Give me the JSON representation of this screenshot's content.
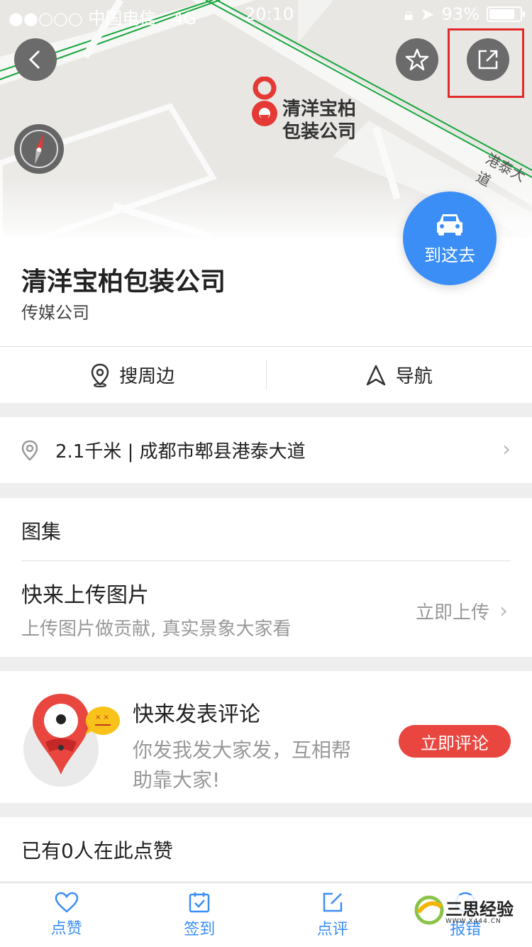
{
  "status_bar": {
    "signal": "●●○○○",
    "carrier": "中国电信",
    "network": "4G",
    "time": "20:10",
    "battery_percent": "93%",
    "battery_level": 0.93
  },
  "map": {
    "pin_label_line1": "清洋宝柏",
    "pin_label_line2": "包装公司",
    "road_label": "港泰大道",
    "go_button_label": "到这去"
  },
  "place": {
    "name": "清洋宝柏包装公司",
    "category": "传媒公司"
  },
  "actions": {
    "nearby_label": "搜周边",
    "navigate_label": "导航"
  },
  "address": {
    "text": "2.1千米 | 成都市郫县港泰大道"
  },
  "gallery": {
    "heading": "图集",
    "upload_title": "快来上传图片",
    "upload_subtitle": "上传图片做贡献, 真实景象大家看",
    "upload_link": "立即上传"
  },
  "review": {
    "title": "快来发表评论",
    "subtitle_line1": "你发我发大家发，互相帮",
    "subtitle_line2": "助靠大家!",
    "button_label": "立即评论"
  },
  "likes": {
    "text": "已有0人在此点赞"
  },
  "tabbar": {
    "like": "点赞",
    "checkin": "签到",
    "comment": "点评",
    "report": "报错"
  },
  "watermark": {
    "brand": "三思经验",
    "url": "WWW.X444.CN"
  },
  "colors": {
    "accent_blue": "#3a8ef6",
    "review_red": "#e8463f",
    "highlight_box": "#e02b2b"
  }
}
